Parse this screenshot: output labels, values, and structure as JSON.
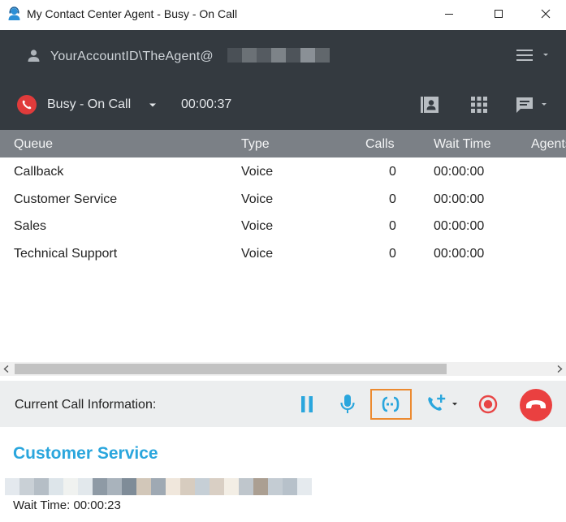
{
  "window": {
    "title": "My Contact Center Agent - Busy - On Call"
  },
  "header": {
    "account": "YourAccountID\\TheAgent@",
    "status_label": "Busy - On Call",
    "call_timer": "00:00:37"
  },
  "queue_table": {
    "columns": [
      "Queue",
      "Type",
      "Calls",
      "Wait Time",
      "Agents"
    ],
    "rows": [
      {
        "queue": "Callback",
        "type": "Voice",
        "calls": "0",
        "wait": "00:00:00"
      },
      {
        "queue": "Customer Service",
        "type": "Voice",
        "calls": "0",
        "wait": "00:00:00"
      },
      {
        "queue": "Sales",
        "type": "Voice",
        "calls": "0",
        "wait": "00:00:00"
      },
      {
        "queue": "Technical Support",
        "type": "Voice",
        "calls": "0",
        "wait": "00:00:00"
      }
    ]
  },
  "call_controls": {
    "label": "Current Call Information:"
  },
  "current_call": {
    "queue": "Customer Service",
    "wait_time": "Wait Time: 00:00:23"
  },
  "colors": {
    "header_bg": "#343a40",
    "table_header_bg": "#7b8086",
    "accent_blue": "#2aa6dd",
    "hangup_red": "#ea4040",
    "highlight_orange": "#ec8a30"
  },
  "icons": {
    "app": "agent-headset-icon",
    "user": "user-icon",
    "menu": "hamburger-menu-icon",
    "status": "phone-call-icon",
    "contacts": "contact-book-icon",
    "dialpad": "dialpad-icon",
    "chat": "chat-bubble-icon",
    "hold": "pause-icon",
    "mute": "microphone-icon",
    "transfer": "transfer-icon",
    "conference": "add-call-icon",
    "record": "record-icon",
    "hangup": "hang-up-icon"
  }
}
